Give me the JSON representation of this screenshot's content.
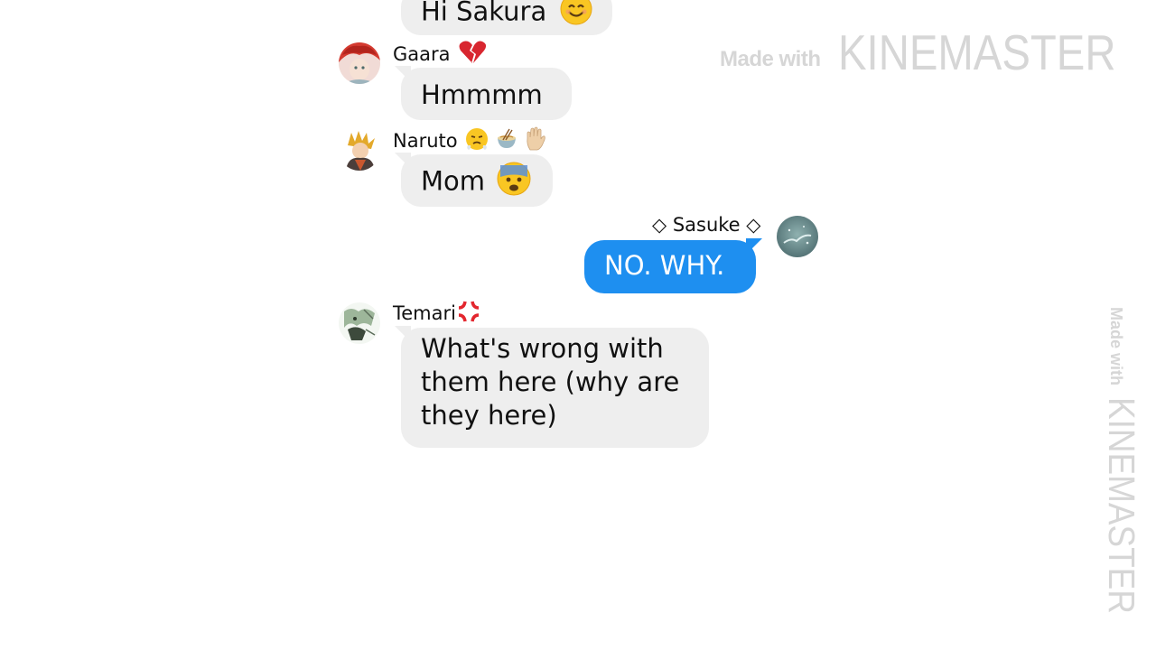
{
  "chat": {
    "messages": [
      {
        "sender": "",
        "sender_emoji": "",
        "text": "Hi Sakura",
        "text_emoji": "smiling-face",
        "mine": false
      },
      {
        "sender": "Gaara",
        "sender_emoji": "broken-heart",
        "text": "Hmmmm",
        "text_emoji": "",
        "mine": false
      },
      {
        "sender": "Naruto",
        "sender_emoji": "steam-face, ramen-bowl, raised-hand",
        "text": "Mom",
        "text_emoji": "anxious-face",
        "mine": false
      },
      {
        "sender": "◇ Sasuke ◇",
        "sender_emoji": "",
        "text": "NO. WHY.",
        "text_emoji": "",
        "mine": true
      },
      {
        "sender": "Temari",
        "sender_emoji": "anger-symbol",
        "text_lines": [
          "What's wrong with",
          "them here (why are",
          "they here)"
        ],
        "text_emoji": "",
        "mine": false
      }
    ]
  },
  "watermark": {
    "prefix": "Made with",
    "brand": "KINEMASTER"
  },
  "colors": {
    "incoming_bubble": "#eeeeee",
    "outgoing_bubble": "#1e8ff0",
    "watermark": "#d6d6d6"
  }
}
